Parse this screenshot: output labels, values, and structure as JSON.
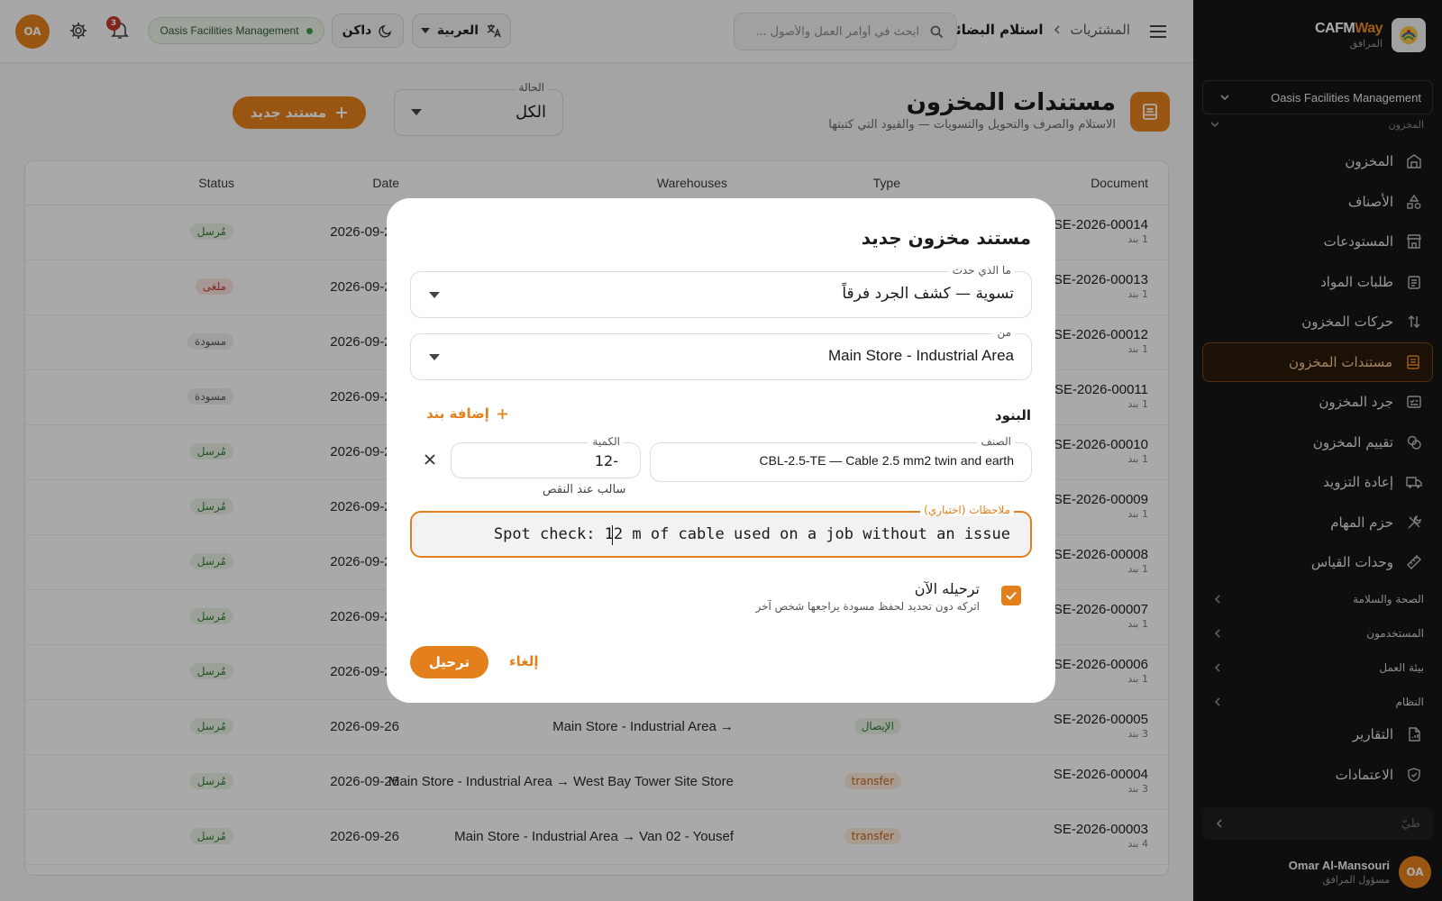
{
  "sidebar": {
    "brand_name_main": "CAFM",
    "brand_name_accent": "Way",
    "brand_sub": "المرافق",
    "org": "Oasis Facilities Management",
    "section_peek": "المخزون",
    "items": [
      {
        "label": "المخزون",
        "icon": "warehouse-icon"
      },
      {
        "label": "الأصناف",
        "icon": "shapes-icon"
      },
      {
        "label": "المستودعات",
        "icon": "store-icon"
      },
      {
        "label": "طلبات المواد",
        "icon": "clipboard-icon"
      },
      {
        "label": "حركات المخزون",
        "icon": "arrows-updown-icon"
      },
      {
        "label": "مستندات المخزون",
        "icon": "document-icon",
        "active": true
      },
      {
        "label": "جرد المخزون",
        "icon": "checklist-icon"
      },
      {
        "label": "تقييم المخزون",
        "icon": "coins-icon"
      },
      {
        "label": "إعادة التزويد",
        "icon": "truck-icon"
      },
      {
        "label": "حزم المهام",
        "icon": "tools-icon"
      },
      {
        "label": "وحدات القياس",
        "icon": "ruler-icon"
      }
    ],
    "groups": [
      "الصحة والسلامة",
      "المستخدمون",
      "بيئة العمل",
      "النظام"
    ],
    "items2": [
      {
        "label": "التقارير",
        "icon": "report-icon"
      },
      {
        "label": "الاعتمادات",
        "icon": "shield-check-icon"
      }
    ],
    "collapse_label": "طيّ",
    "user_initials": "OA",
    "user_name": "Omar Al-Mansouri",
    "user_role": "مسؤول المرافق"
  },
  "topbar": {
    "crumb_parent": "المشتريات",
    "crumb_current": "استلام البضائع",
    "search_placeholder": "ابحث في أوامر العمل والأصول ...",
    "language": "العربية",
    "theme": "داكن",
    "org_pill": "Oasis Facilities Management",
    "notification_count": "3",
    "avatar_initials": "OA"
  },
  "page": {
    "title": "مستندات المخزون",
    "subtitle": "الاستلام والصرف والتحويل والتسويات — والقيود التي كتبتها",
    "status_label": "الحالة",
    "status_value": "الكل",
    "new_button": "مستند جديد"
  },
  "table": {
    "headers": {
      "document": "Document",
      "type": "Type",
      "warehouses": "Warehouses",
      "date": "Date",
      "status": "Status"
    },
    "rows": [
      {
        "id": "SE-2026-00014",
        "lines": "1 بند",
        "type": "",
        "type_kind": "",
        "warehouses": "",
        "date": "2026-09-26",
        "status": "مُرسل",
        "status_kind": "green"
      },
      {
        "id": "SE-2026-00013",
        "lines": "1 بند",
        "type": "",
        "type_kind": "",
        "warehouses": "",
        "date": "2026-09-26",
        "status": "ملغى",
        "status_kind": "red"
      },
      {
        "id": "SE-2026-00012",
        "lines": "1 بند",
        "type": "",
        "type_kind": "",
        "warehouses": "",
        "date": "2026-09-26",
        "status": "مسودة",
        "status_kind": "gray"
      },
      {
        "id": "SE-2026-00011",
        "lines": "1 بند",
        "type": "",
        "type_kind": "",
        "warehouses": "",
        "date": "2026-09-26",
        "status": "مسودة",
        "status_kind": "gray"
      },
      {
        "id": "SE-2026-00010",
        "lines": "1 بند",
        "type": "",
        "type_kind": "",
        "warehouses": "",
        "date": "2026-09-26",
        "status": "مُرسل",
        "status_kind": "green"
      },
      {
        "id": "SE-2026-00009",
        "lines": "1 بند",
        "type": "",
        "type_kind": "",
        "warehouses": "",
        "date": "2026-09-26",
        "status": "مُرسل",
        "status_kind": "green"
      },
      {
        "id": "SE-2026-00008",
        "lines": "1 بند",
        "type": "",
        "type_kind": "",
        "warehouses": "",
        "date": "2026-09-26",
        "status": "مُرسل",
        "status_kind": "green"
      },
      {
        "id": "SE-2026-00007",
        "lines": "1 بند",
        "type": "",
        "type_kind": "",
        "warehouses": "",
        "date": "2026-09-26",
        "status": "مُرسل",
        "status_kind": "green"
      },
      {
        "id": "SE-2026-00006",
        "lines": "1 بند",
        "type": "",
        "type_kind": "",
        "warehouses": "",
        "date": "2026-09-26",
        "status": "مُرسل",
        "status_kind": "green"
      },
      {
        "id": "SE-2026-00005",
        "lines": "3 بند",
        "type": "الإيصال",
        "type_kind": "green",
        "warehouses": "Main Store - Industrial Area →",
        "date": "2026-09-26",
        "status": "مُرسل",
        "status_kind": "green"
      },
      {
        "id": "SE-2026-00004",
        "lines": "3 بند",
        "type": "transfer",
        "type_kind": "orange",
        "warehouses": "Main Store - Industrial Area → West Bay Tower Site Store",
        "date": "2026-09-26",
        "status": "مُرسل",
        "status_kind": "green"
      },
      {
        "id": "SE-2026-00003",
        "lines": "4 بند",
        "type": "transfer",
        "type_kind": "orange",
        "warehouses": "Main Store - Industrial Area → Van 02 - Yousef",
        "date": "2026-09-26",
        "status": "مُرسل",
        "status_kind": "green"
      }
    ]
  },
  "modal": {
    "title": "مستند مخزون جديد",
    "what_label": "ما الذي حدث",
    "what_value": "تسوية — كشف الجرد فرقاً",
    "from_label": "من",
    "from_value": "Main Store - Industrial Area",
    "lines_label": "البنود",
    "add_line": "إضافة بند",
    "item_label": "الصنف",
    "item_value": "CBL-2.5-TE — Cable 2.5 mm2 twin and earth",
    "qty_label": "الكمية",
    "qty_value": "-12",
    "qty_hint": "سالب عند النقص",
    "notes_label": "ملاحظات (اختياري)",
    "notes_value": "Spot check: 12 m of cable used on a job without an issue",
    "post_now_label": "ترحيله الآن",
    "post_now_hint": "اتركه دون تحديد لحفظ مسودة يراجعها شخص آخر",
    "post_now_checked": true,
    "cancel": "إلغاء",
    "submit": "ترحيل"
  },
  "colors": {
    "accent": "#e3801c",
    "sidebar_bg": "#161616",
    "success": "#2e7d32",
    "danger": "#c0392b"
  }
}
